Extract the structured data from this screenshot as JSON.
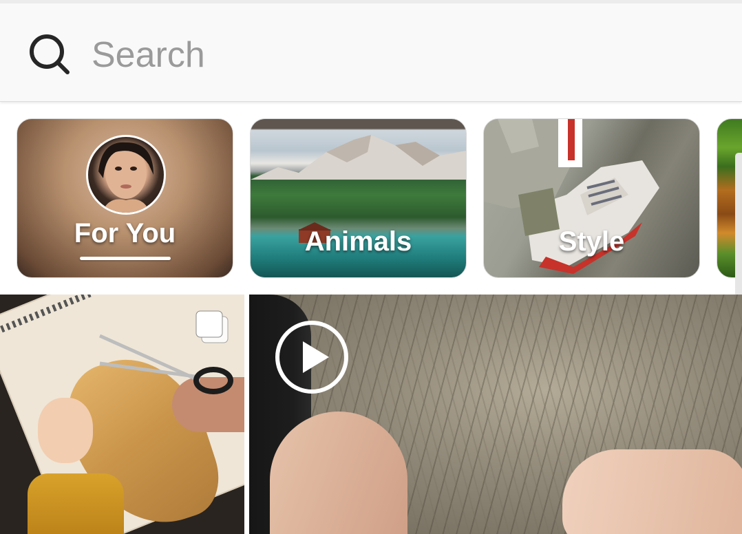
{
  "search": {
    "placeholder": "Search"
  },
  "categories": [
    {
      "label": "For You",
      "selected": true
    },
    {
      "label": "Animals",
      "selected": false
    },
    {
      "label": "Style",
      "selected": false
    }
  ],
  "grid": {
    "tiles": [
      {
        "type": "carousel",
        "icon": "multiple-photos-icon"
      },
      {
        "type": "video",
        "icon": "play-icon"
      }
    ]
  },
  "colors": {
    "search_background": "#f9f9f9",
    "placeholder_text": "#9a9a9a",
    "label_text": "#ffffff"
  }
}
